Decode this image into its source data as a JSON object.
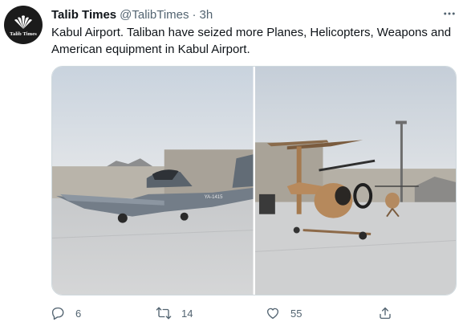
{
  "tweet": {
    "avatar_text": "Talib Times",
    "name": "Talib Times",
    "handle": "@TalibTimes",
    "separator": "·",
    "time": "3h",
    "text": "Kabul Airport. Taliban have seized more Planes, Helicopters, Weapons and American equipment in Kabul Airport.",
    "images": [
      {
        "icon": "airplane-photo"
      },
      {
        "icon": "helicopter-photo"
      }
    ],
    "actions": {
      "reply_count": "6",
      "retweet_count": "14",
      "like_count": "55"
    }
  },
  "colors": {
    "text": "#0f1419",
    "secondary": "#536471",
    "border": "#cfd9de"
  }
}
